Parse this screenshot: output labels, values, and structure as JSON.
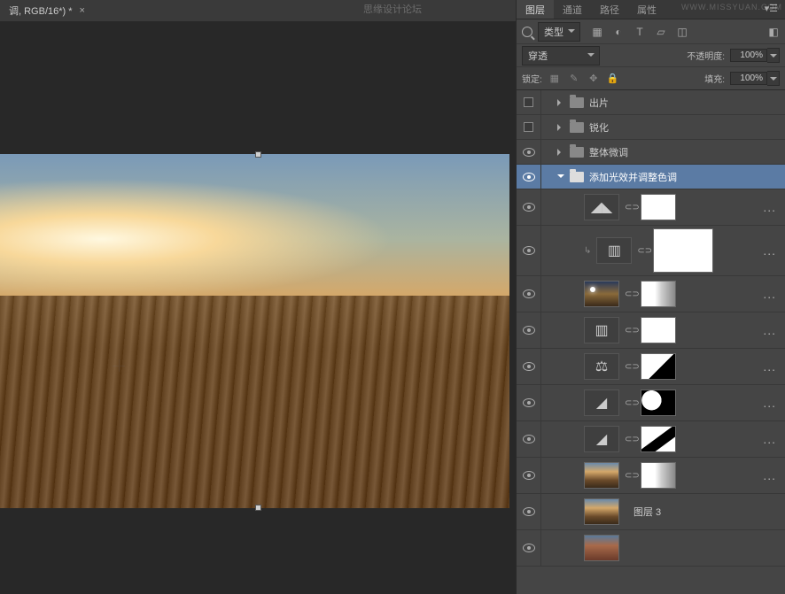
{
  "watermark_center": "思缘设计论坛",
  "watermark_right": "WWW.MISSYUAN.COM",
  "tab": {
    "title": "调, RGB/16*) *",
    "close": "×"
  },
  "panel_tabs": [
    "图层",
    "通道",
    "路径",
    "属性"
  ],
  "panel_menu": "▾☰",
  "filter": {
    "type_label": "类型",
    "icons": {
      "image": "▦",
      "adjust": "◐",
      "text": "T",
      "shape": "▱",
      "smart": "◫",
      "switch": "◧"
    }
  },
  "blend": {
    "mode": "穿透",
    "opacity_label": "不透明度:",
    "opacity_val": "100%"
  },
  "lock": {
    "label": "锁定:",
    "fill_label": "填充:",
    "fill_val": "100%",
    "icons": {
      "pixels": "▦",
      "brush": "✎",
      "move": "✥",
      "all": "🔒"
    }
  },
  "groups": {
    "g1": "出片",
    "g2": "锐化",
    "g3": "整体微调",
    "g4": "添加光效并调整色调"
  },
  "adj": {
    "levels": "◢◣",
    "arrow": "↳",
    "curves2": "▥",
    "curves": "▥",
    "balance": "⚖",
    "bright": "◢",
    "bright2": "◢"
  },
  "layer3_name": "图层 3",
  "link": "⊂⊃",
  "ellipsis": "..."
}
